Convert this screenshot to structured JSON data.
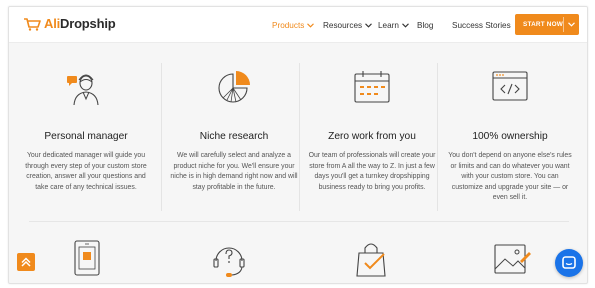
{
  "brand": {
    "name_part1": "Ali",
    "name_part2": "Dropship"
  },
  "nav": {
    "items": [
      {
        "label": "Products",
        "has_dropdown": true,
        "active": true
      },
      {
        "label": "Resources",
        "has_dropdown": true,
        "active": false
      },
      {
        "label": "Learn",
        "has_dropdown": true,
        "active": false
      },
      {
        "label": "Blog",
        "has_dropdown": false,
        "active": false
      },
      {
        "label": "Success Stories",
        "has_dropdown": false,
        "active": false
      }
    ],
    "cta_label": "START NOW"
  },
  "features": [
    {
      "icon": "manager-icon",
      "title": "Personal manager",
      "description": "Your dedicated manager will guide you through every step of your custom store creation, answer all your questions and take care of any technical issues."
    },
    {
      "icon": "pie-chart-icon",
      "title": "Niche research",
      "description": "We will carefully select and analyze a product niche for you. We'll ensure your niche is in high demand right now and will stay profitable in the future."
    },
    {
      "icon": "calendar-icon",
      "title": "Zero work from you",
      "description": "Our team of professionals will create your store from A all the way to Z. In just a few days you'll get a turnkey dropshipping business ready to bring you profits."
    },
    {
      "icon": "code-browser-icon",
      "title": "100% ownership",
      "description": "You don't depend on anyone else's rules or limits and can do whatever you want with your custom store. You can customize and upgrade your site — or even sell it."
    }
  ],
  "bottom_icons": [
    "tablet-icon",
    "support-headset-icon",
    "shopping-bag-check-icon",
    "image-edit-icon"
  ],
  "colors": {
    "accent": "#f08a1c",
    "chat": "#1a73e8"
  }
}
